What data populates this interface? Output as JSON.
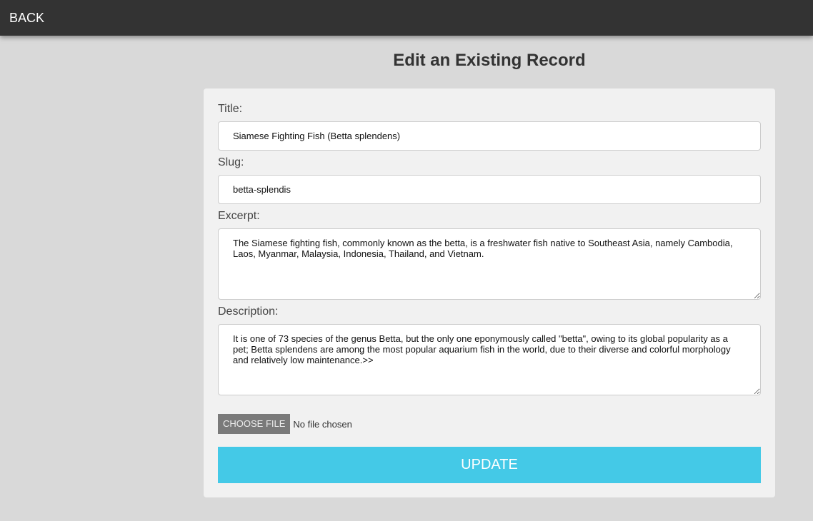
{
  "nav": {
    "back_label": "BACK"
  },
  "page": {
    "title": "Edit an Existing Record"
  },
  "form": {
    "title_label": "Title:",
    "title_value": "Siamese Fighting Fish (Betta splendens)",
    "slug_label": "Slug:",
    "slug_value": "betta-splendis",
    "excerpt_label": "Excerpt:",
    "excerpt_value": "The Siamese fighting fish, commonly known as the betta, is a freshwater fish native to Southeast Asia, namely Cambodia, Laos, Myanmar, Malaysia, Indonesia, Thailand, and Vietnam.",
    "description_label": "Description:",
    "description_value": "It is one of 73 species of the genus Betta, but the only one eponymously called \"betta\", owing to its global popularity as a pet; Betta splendens are among the most popular aquarium fish in the world, due to their diverse and colorful morphology and relatively low maintenance.>>",
    "file_button_label": "CHOOSE FILE",
    "file_status": "No file chosen",
    "submit_label": "UPDATE"
  },
  "colors": {
    "page_background": "#d9d9d9",
    "topbar": "#333333",
    "card": "#f1f1f1",
    "accent_button": "#44c9e7",
    "file_button": "#7a7a7a"
  }
}
